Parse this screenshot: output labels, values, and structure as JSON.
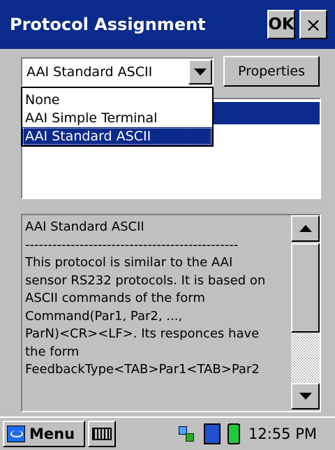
{
  "window": {
    "title": "Protocol Assignment",
    "ok_label": "OK",
    "close_label": "×"
  },
  "protocol_select": {
    "selected_value": "AAI Standard ASCII",
    "options": [
      "None",
      "AAI Simple Terminal",
      "AAI Standard ASCII"
    ]
  },
  "properties_button": {
    "label": "Properties"
  },
  "description": {
    "lines": [
      "AAI Standard ASCII",
      "-----------------------------------------------",
      "This protocol is similar to the AAI",
      "sensor RS232 protocols. It is based on",
      "ASCII commands of the form",
      "Command(Par1, Par2, ...,",
      "ParN)<CR><LF>. Its responces have",
      "the form",
      "FeedbackType<TAB>Par1<TAB>Par2"
    ]
  },
  "taskbar": {
    "menu_label": "Menu",
    "clock": "12:55 PM"
  },
  "colors": {
    "titlebar": "#0a2a8c",
    "selection": "#0a2a8c",
    "face": "#c0c0c0"
  }
}
